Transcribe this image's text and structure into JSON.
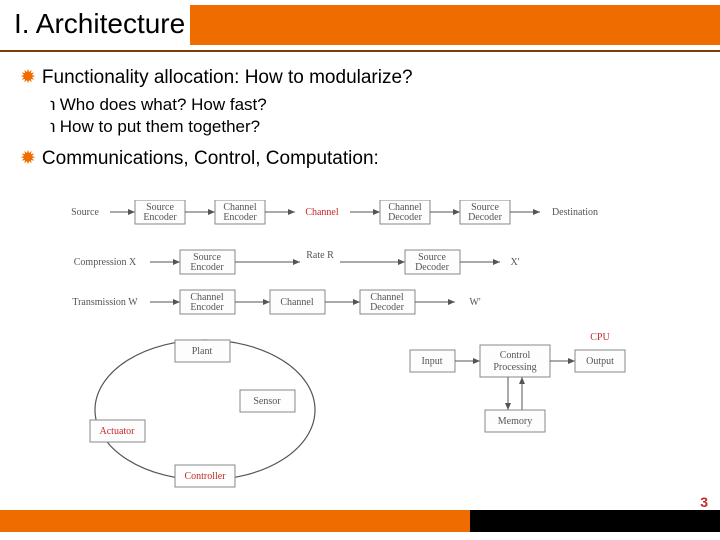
{
  "header": {
    "title": "I. Architecture"
  },
  "bullets": {
    "b1": "Functionality allocation: How to modularize?",
    "b1a": "Who does what? How fast?",
    "b1b": "How to put them together?",
    "b2": "Communications, Control, Computation:"
  },
  "diagram": {
    "comm_chain": {
      "nodes": [
        "Source",
        "Source Encoder",
        "Channel Encoder",
        "Channel",
        "Channel Decoder",
        "Source Decoder",
        "Destination"
      ],
      "red_index": 3
    },
    "compression": {
      "left_label": "Compression X",
      "mid1": "Source Encoder",
      "rate": "Rate R",
      "mid2": "Source Decoder",
      "out": "X'"
    },
    "transmission": {
      "left_label": "Transmission W",
      "mid1": "Channel Encoder",
      "mid2": "Channel",
      "mid3": "Channel Decoder",
      "out": "W'"
    },
    "control_loop": {
      "plant": "Plant",
      "sensor": "Sensor",
      "actuator": "Actuator",
      "controller": "Controller"
    },
    "cpu": {
      "title": "CPU",
      "input": "Input",
      "core": "Control Processing",
      "output": "Output",
      "memory": "Memory"
    }
  },
  "page": "3"
}
